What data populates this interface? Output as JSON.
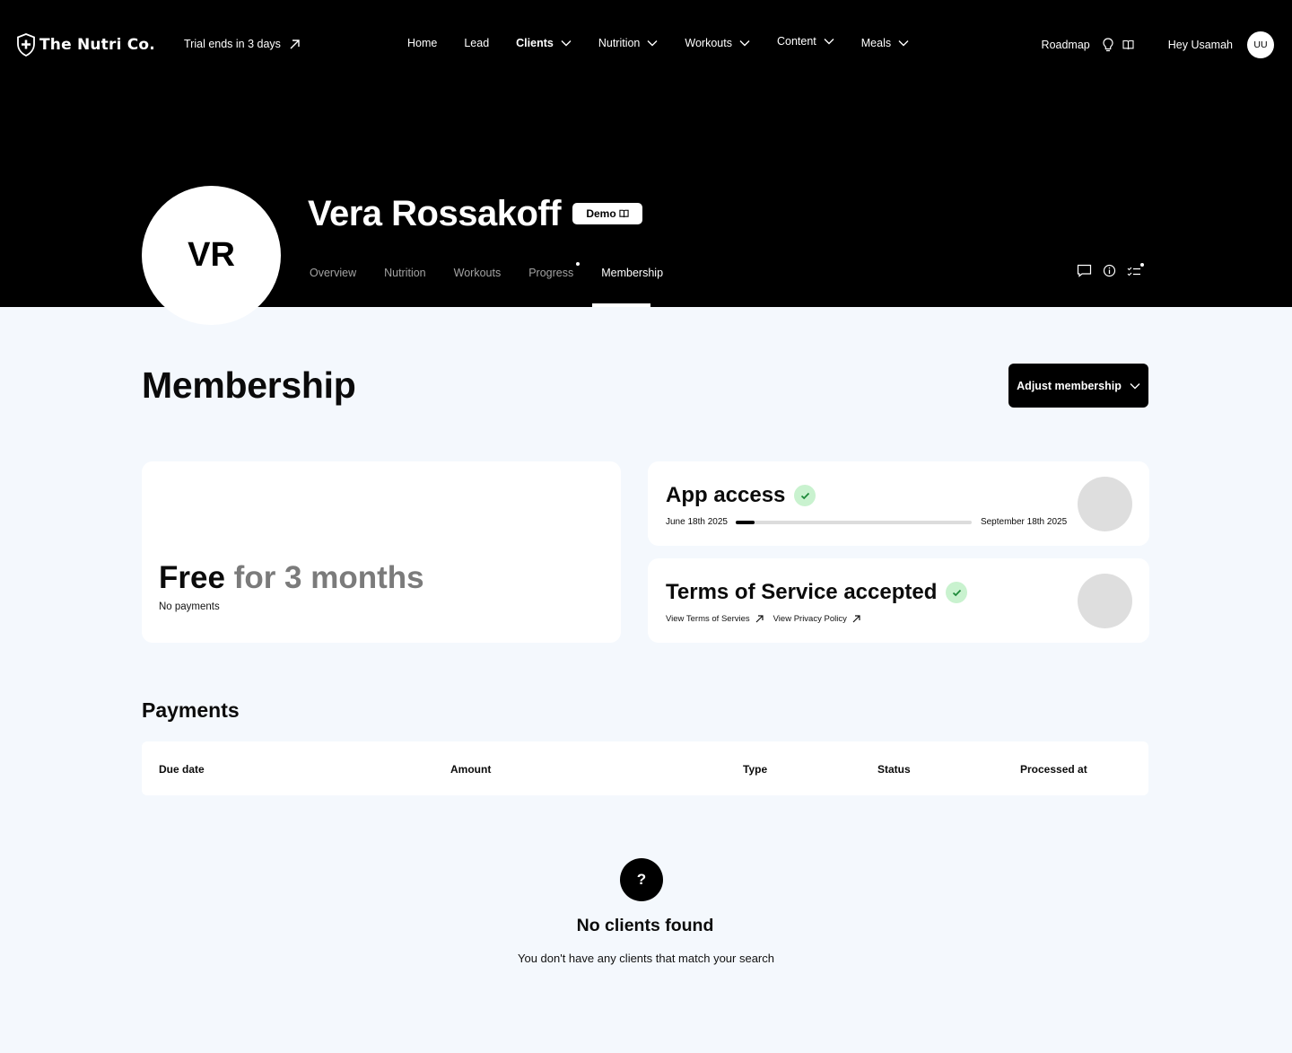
{
  "brand": {
    "name": "The Nutri Co."
  },
  "trial": {
    "label": "Trial ends in 3 days"
  },
  "nav": {
    "items": [
      {
        "label": "Home",
        "dropdown": false,
        "active": false
      },
      {
        "label": "Lead",
        "dropdown": false,
        "active": false
      },
      {
        "label": "Clients",
        "dropdown": true,
        "active": true
      },
      {
        "label": "Nutrition",
        "dropdown": true,
        "active": false
      },
      {
        "label": "Workouts",
        "dropdown": true,
        "active": false
      },
      {
        "label": "Content",
        "dropdown": true,
        "active": false
      },
      {
        "label": "Meals",
        "dropdown": true,
        "active": false
      }
    ],
    "roadmap": "Roadmap",
    "greeting": "Hey Usamah",
    "user_initials": "UU"
  },
  "client": {
    "initials": "VR",
    "name": "Vera Rossakoff",
    "badge": "Demo"
  },
  "tabs": [
    {
      "label": "Overview"
    },
    {
      "label": "Nutrition"
    },
    {
      "label": "Workouts"
    },
    {
      "label": "Progress"
    },
    {
      "label": "Membership"
    }
  ],
  "tab_state": {
    "active": "Membership",
    "notification_on": "Progress"
  },
  "page": {
    "title": "Membership",
    "adjust_button": "Adjust membership"
  },
  "plan": {
    "price": "Free",
    "duration": "for 3 months",
    "subtitle": "No payments"
  },
  "app_access": {
    "title": "App access",
    "start_date": "June 18th 2025",
    "end_date": "September 18th 2025",
    "progress": 0.08
  },
  "tos": {
    "title": "Terms of Service accepted",
    "link_terms": "View Terms of Servies",
    "link_privacy": "View Privacy Policy"
  },
  "payments": {
    "title": "Payments",
    "columns": [
      "Due date",
      "Amount",
      "Type",
      "Status",
      "Processed at"
    ]
  },
  "empty_state": {
    "icon": "?",
    "title": "No clients found",
    "message": "You don't have any clients that match your search"
  },
  "colors": {
    "header_bg": "#000000",
    "page_bg": "#f4f8fd",
    "check_bg": "#c9f2cf",
    "check_fg": "#1e8a3a",
    "muted_text": "#7b7b7b"
  }
}
